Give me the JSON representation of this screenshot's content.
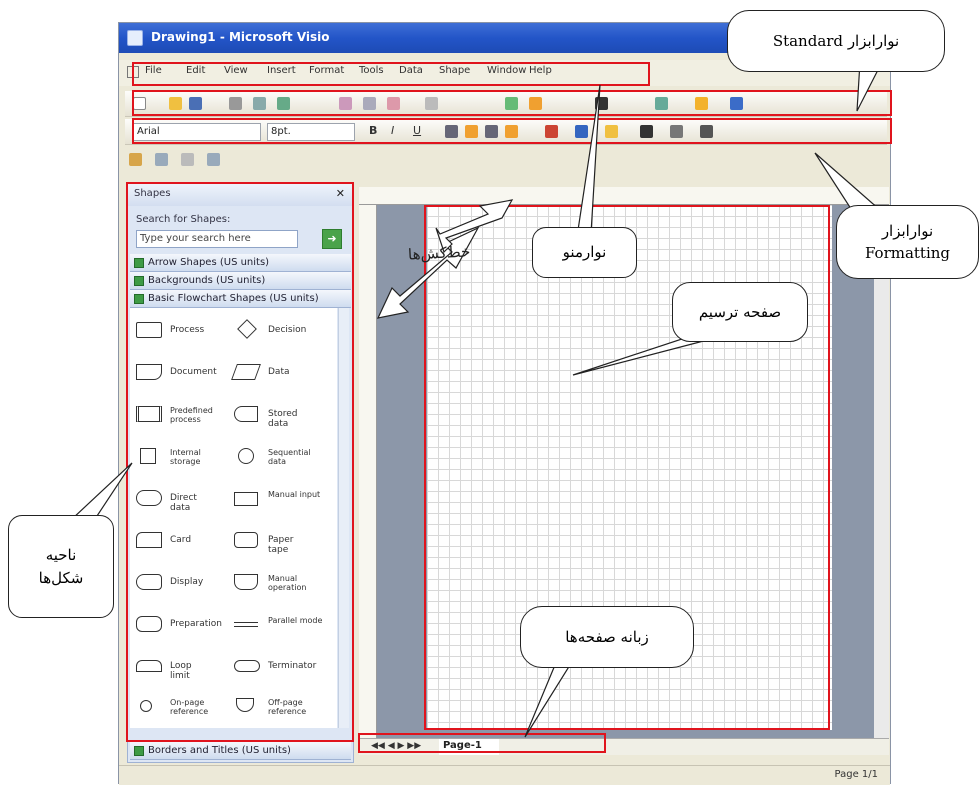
{
  "window": {
    "title": "Drawing1 - Microsoft Visio"
  },
  "menu": [
    "File",
    "Edit",
    "View",
    "Insert",
    "Format",
    "Tools",
    "Data",
    "Shape",
    "Window",
    "Help"
  ],
  "formatting": {
    "font": "Arial",
    "size": "8pt."
  },
  "shapes_pane": {
    "title": "Shapes",
    "search_label": "Search for Shapes:",
    "search_placeholder": "Type your search here",
    "stencils": [
      "Arrow Shapes (US units)",
      "Backgrounds (US units)",
      "Basic Flowchart Shapes (US units)"
    ],
    "shapes": [
      {
        "left": "Process",
        "right": "Decision"
      },
      {
        "left": "Document",
        "right": "Data"
      },
      {
        "left": "Predefined process",
        "right": "Stored data"
      },
      {
        "left": "Internal storage",
        "right": "Sequential data"
      },
      {
        "left": "Direct data",
        "right": "Manual input"
      },
      {
        "left": "Card",
        "right": "Paper tape"
      },
      {
        "left": "Display",
        "right": "Manual operation"
      },
      {
        "left": "Preparation",
        "right": "Parallel mode"
      },
      {
        "left": "Loop limit",
        "right": "Terminator"
      },
      {
        "left": "On-page reference",
        "right": "Off-page reference"
      }
    ],
    "bottom_stencil": "Borders and Titles (US units)"
  },
  "page_tab": "Page-1",
  "status": "Page 1/1",
  "callouts": {
    "standard": "نوارابزار Standard",
    "formatting_l1": "نوارابزار",
    "formatting_l2": "Formatting",
    "menubar": "نوارمنو",
    "rulers": "خط‌کش‌ها",
    "drawing_page": "صفحه ترسیم",
    "page_tabs": "زبانه صفحه‌ها",
    "shapes_area_l1": "ناحیه",
    "shapes_area_l2": "شکل‌ها"
  }
}
